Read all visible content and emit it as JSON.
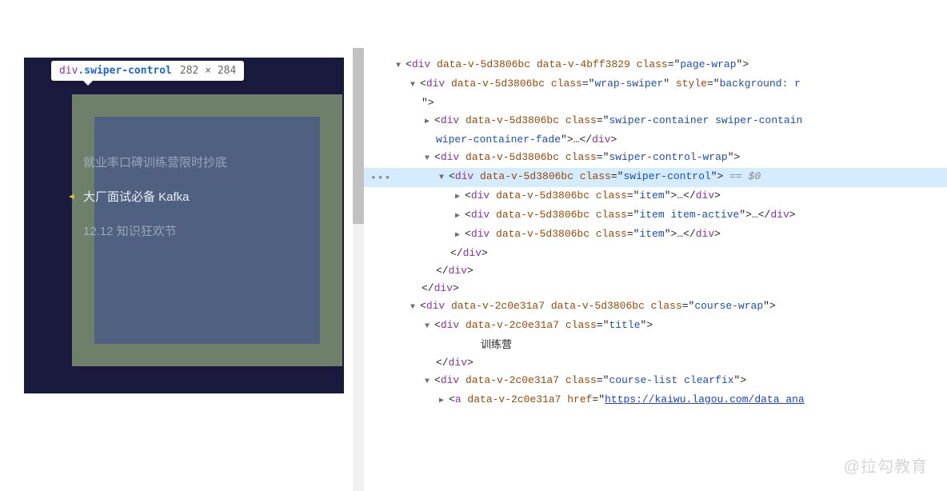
{
  "tooltip": {
    "tag": "div",
    "cls": ".swiper-control",
    "dims": "282 × 284"
  },
  "preview": {
    "items": [
      {
        "label": "就业率口碑训练营限时抄底",
        "active": false
      },
      {
        "label": "大厂面试必备 Kafka",
        "active": true
      },
      {
        "label": "12.12 知识狂欢节",
        "active": false
      }
    ]
  },
  "dom": {
    "lines": [
      {
        "indent": 0,
        "arrow": "▼",
        "tokens": [
          [
            "<",
            "punct"
          ],
          [
            "div",
            "tagname"
          ],
          [
            " data-v-5d3806bc",
            "attrname"
          ],
          [
            " data-v-4bff3829",
            "attrname"
          ],
          [
            " class",
            "attrname"
          ],
          [
            "=",
            "equals"
          ],
          [
            "\"",
            "quote"
          ],
          [
            "page-wrap",
            "attrval"
          ],
          [
            "\"",
            "quote"
          ],
          [
            ">",
            "punct"
          ]
        ]
      },
      {
        "indent": 1,
        "arrow": "▼",
        "tokens": [
          [
            "<",
            "punct"
          ],
          [
            "div",
            "tagname"
          ],
          [
            " data-v-5d3806bc",
            "attrname"
          ],
          [
            " class",
            "attrname"
          ],
          [
            "=",
            "equals"
          ],
          [
            "\"",
            "quote"
          ],
          [
            "wrap-swiper",
            "attrval"
          ],
          [
            "\"",
            "quote"
          ],
          [
            " style",
            "attrname"
          ],
          [
            "=",
            "equals"
          ],
          [
            "\"",
            "quote"
          ],
          [
            "background: r",
            "attrval"
          ]
        ]
      },
      {
        "indent": 1,
        "arrow": "",
        "tokens": [
          [
            "\"",
            "quote"
          ],
          [
            ">",
            "punct"
          ]
        ]
      },
      {
        "indent": 2,
        "arrow": "▶",
        "tokens": [
          [
            "<",
            "punct"
          ],
          [
            "div",
            "tagname"
          ],
          [
            " data-v-5d3806bc",
            "attrname"
          ],
          [
            " class",
            "attrname"
          ],
          [
            "=",
            "equals"
          ],
          [
            "\"",
            "quote"
          ],
          [
            "swiper-container swiper-contain",
            "attrval"
          ]
        ]
      },
      {
        "indent": 2,
        "arrow": "",
        "tokens": [
          [
            "wiper-container-fade",
            "attrval"
          ],
          [
            "\"",
            "quote"
          ],
          [
            ">",
            "punct"
          ],
          [
            "…",
            "ellipsis"
          ],
          [
            "</",
            "punct"
          ],
          [
            "div",
            "tagname"
          ],
          [
            ">",
            "punct"
          ]
        ]
      },
      {
        "indent": 2,
        "arrow": "▼",
        "tokens": [
          [
            "<",
            "punct"
          ],
          [
            "div",
            "tagname"
          ],
          [
            " data-v-5d3806bc",
            "attrname"
          ],
          [
            " class",
            "attrname"
          ],
          [
            "=",
            "equals"
          ],
          [
            "\"",
            "quote"
          ],
          [
            "swiper-control-wrap",
            "attrval"
          ],
          [
            "\"",
            "quote"
          ],
          [
            ">",
            "punct"
          ]
        ]
      },
      {
        "indent": 3,
        "arrow": "▼",
        "selected": true,
        "gutter": "•••",
        "tokens": [
          [
            "<",
            "punct"
          ],
          [
            "div",
            "tagname"
          ],
          [
            " data-v-5d3806bc",
            "attrname"
          ],
          [
            " class",
            "attrname"
          ],
          [
            "=",
            "equals"
          ],
          [
            "\"",
            "quote"
          ],
          [
            "swiper-control",
            "attrval"
          ],
          [
            "\"",
            "quote"
          ],
          [
            ">",
            "punct"
          ],
          [
            " == $0",
            "eqvar"
          ]
        ]
      },
      {
        "indent": 4,
        "arrow": "▶",
        "tokens": [
          [
            "<",
            "punct"
          ],
          [
            "div",
            "tagname"
          ],
          [
            " data-v-5d3806bc",
            "attrname"
          ],
          [
            " class",
            "attrname"
          ],
          [
            "=",
            "equals"
          ],
          [
            "\"",
            "quote"
          ],
          [
            "item",
            "attrval"
          ],
          [
            "\"",
            "quote"
          ],
          [
            ">",
            "punct"
          ],
          [
            "…",
            "ellipsis"
          ],
          [
            "</",
            "punct"
          ],
          [
            "div",
            "tagname"
          ],
          [
            ">",
            "punct"
          ]
        ]
      },
      {
        "indent": 4,
        "arrow": "▶",
        "tokens": [
          [
            "<",
            "punct"
          ],
          [
            "div",
            "tagname"
          ],
          [
            " data-v-5d3806bc",
            "attrname"
          ],
          [
            " class",
            "attrname"
          ],
          [
            "=",
            "equals"
          ],
          [
            "\"",
            "quote"
          ],
          [
            "item item-active",
            "attrval"
          ],
          [
            "\"",
            "quote"
          ],
          [
            ">",
            "punct"
          ],
          [
            "…",
            "ellipsis"
          ],
          [
            "</",
            "punct"
          ],
          [
            "div",
            "tagname"
          ],
          [
            ">",
            "punct"
          ]
        ]
      },
      {
        "indent": 4,
        "arrow": "▶",
        "tokens": [
          [
            "<",
            "punct"
          ],
          [
            "div",
            "tagname"
          ],
          [
            " data-v-5d3806bc",
            "attrname"
          ],
          [
            " class",
            "attrname"
          ],
          [
            "=",
            "equals"
          ],
          [
            "\"",
            "quote"
          ],
          [
            "item",
            "attrval"
          ],
          [
            "\"",
            "quote"
          ],
          [
            ">",
            "punct"
          ],
          [
            "…",
            "ellipsis"
          ],
          [
            "</",
            "punct"
          ],
          [
            "div",
            "tagname"
          ],
          [
            ">",
            "punct"
          ]
        ]
      },
      {
        "indent": 3,
        "arrow": "",
        "tokens": [
          [
            "</",
            "punct"
          ],
          [
            "div",
            "tagname"
          ],
          [
            ">",
            "punct"
          ]
        ]
      },
      {
        "indent": 2,
        "arrow": "",
        "tokens": [
          [
            "</",
            "punct"
          ],
          [
            "div",
            "tagname"
          ],
          [
            ">",
            "punct"
          ]
        ]
      },
      {
        "indent": 1,
        "arrow": "",
        "tokens": [
          [
            "</",
            "punct"
          ],
          [
            "div",
            "tagname"
          ],
          [
            ">",
            "punct"
          ]
        ]
      },
      {
        "indent": 1,
        "arrow": "▼",
        "tokens": [
          [
            "<",
            "punct"
          ],
          [
            "div",
            "tagname"
          ],
          [
            " data-v-2c0e31a7",
            "attrname"
          ],
          [
            " data-v-5d3806bc",
            "attrname"
          ],
          [
            " class",
            "attrname"
          ],
          [
            "=",
            "equals"
          ],
          [
            "\"",
            "quote"
          ],
          [
            "course-wrap",
            "attrval"
          ],
          [
            "\"",
            "quote"
          ],
          [
            ">",
            "punct"
          ]
        ]
      },
      {
        "indent": 2,
        "arrow": "▼",
        "tokens": [
          [
            "<",
            "punct"
          ],
          [
            "div",
            "tagname"
          ],
          [
            " data-v-2c0e31a7",
            "attrname"
          ],
          [
            " class",
            "attrname"
          ],
          [
            "=",
            "equals"
          ],
          [
            "\"",
            "quote"
          ],
          [
            "title",
            "attrval"
          ],
          [
            "\"",
            "quote"
          ],
          [
            ">",
            "punct"
          ]
        ]
      },
      {
        "indent": 5,
        "arrow": "",
        "tokens": [
          [
            "训练营",
            "txt"
          ]
        ]
      },
      {
        "indent": 2,
        "arrow": "",
        "tokens": [
          [
            "</",
            "punct"
          ],
          [
            "div",
            "tagname"
          ],
          [
            ">",
            "punct"
          ]
        ]
      },
      {
        "indent": 2,
        "arrow": "▼",
        "tokens": [
          [
            "<",
            "punct"
          ],
          [
            "div",
            "tagname"
          ],
          [
            " data-v-2c0e31a7",
            "attrname"
          ],
          [
            " class",
            "attrname"
          ],
          [
            "=",
            "equals"
          ],
          [
            "\"",
            "quote"
          ],
          [
            "course-list clearfix",
            "attrval"
          ],
          [
            "\"",
            "quote"
          ],
          [
            ">",
            "punct"
          ]
        ]
      },
      {
        "indent": 3,
        "arrow": "▶",
        "tokens": [
          [
            "<",
            "punct"
          ],
          [
            "a",
            "tagname"
          ],
          [
            " data-v-2c0e31a7",
            "attrname"
          ],
          [
            " href",
            "attrname"
          ],
          [
            "=",
            "equals"
          ],
          [
            "\"",
            "quote"
          ],
          [
            "https://kaiwu.lagou.com/data_ana",
            "link"
          ]
        ]
      }
    ]
  },
  "watermark": "@拉勾教育"
}
